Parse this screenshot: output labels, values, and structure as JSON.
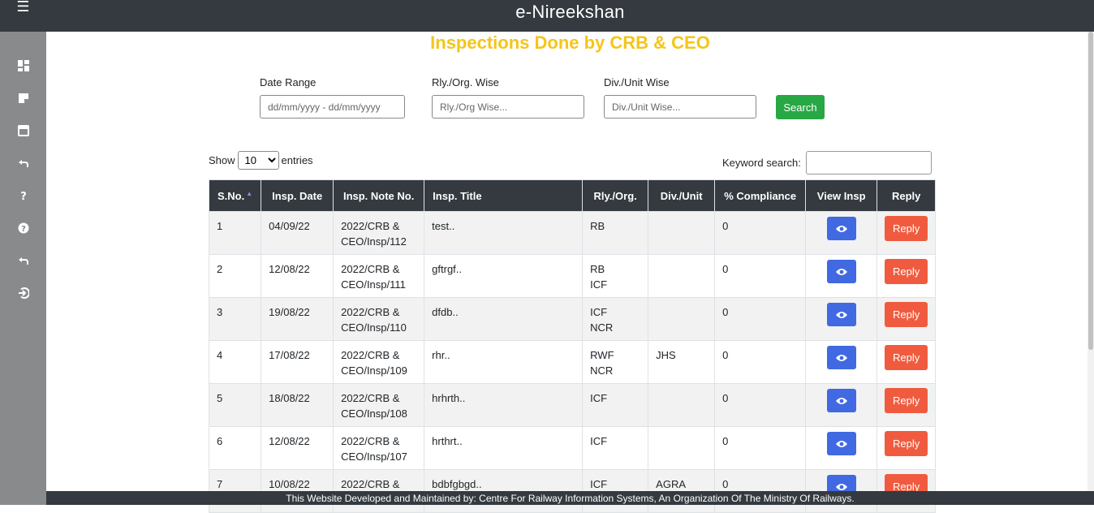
{
  "app": {
    "title": "e-Nireekshan"
  },
  "page": {
    "heading": "Inspections Done by CRB & CEO"
  },
  "filters": {
    "date_range_label": "Date Range",
    "date_range_placeholder": "dd/mm/yyyy - dd/mm/yyyy",
    "rly_label": "Rly./Org. Wise",
    "rly_placeholder": "Rly./Org Wise...",
    "div_label": "Div./Unit Wise",
    "div_placeholder": "Div./Unit Wise...",
    "search_label": "Search"
  },
  "table_controls": {
    "show_label": "Show",
    "entries_value": "10",
    "entries_label": "entries",
    "keyword_label": "Keyword search:"
  },
  "table": {
    "headers": [
      "S.No.",
      "Insp. Date",
      "Insp. Note No.",
      "Insp. Title",
      "Rly./Org.",
      "Div./Unit",
      "% Compliance",
      "View Insp",
      "Reply"
    ],
    "reply_label": "Reply",
    "rows": [
      {
        "sno": "1",
        "date": "04/09/22",
        "note_a": "2022/CRB &",
        "note_b": "CEO/Insp/112",
        "title": "test..",
        "rly_a": "RB",
        "rly_b": "",
        "div": "",
        "compliance": "0"
      },
      {
        "sno": "2",
        "date": "12/08/22",
        "note_a": "2022/CRB &",
        "note_b": "CEO/Insp/111",
        "title": "gftrgf..",
        "rly_a": "RB",
        "rly_b": "ICF",
        "div": "",
        "compliance": "0"
      },
      {
        "sno": "3",
        "date": "19/08/22",
        "note_a": "2022/CRB &",
        "note_b": "CEO/Insp/110",
        "title": "dfdb..",
        "rly_a": "ICF",
        "rly_b": "NCR",
        "div": "",
        "compliance": "0"
      },
      {
        "sno": "4",
        "date": "17/08/22",
        "note_a": "2022/CRB &",
        "note_b": "CEO/Insp/109",
        "title": "rhr..",
        "rly_a": "RWF",
        "rly_b": "NCR",
        "div": "JHS",
        "compliance": "0"
      },
      {
        "sno": "5",
        "date": "18/08/22",
        "note_a": "2022/CRB &",
        "note_b": "CEO/Insp/108",
        "title": "hrhrth..",
        "rly_a": "ICF",
        "rly_b": "",
        "div": "",
        "compliance": "0"
      },
      {
        "sno": "6",
        "date": "12/08/22",
        "note_a": "2022/CRB &",
        "note_b": "CEO/Insp/107",
        "title": "hrthrt..",
        "rly_a": "ICF",
        "rly_b": "",
        "div": "",
        "compliance": "0"
      },
      {
        "sno": "7",
        "date": "10/08/22",
        "note_a": "2022/CRB &",
        "note_b": "",
        "title": "bdbfgbgd..",
        "rly_a": "ICF",
        "rly_b": "",
        "div": "AGRA",
        "compliance": "0"
      }
    ]
  },
  "footer": {
    "text": "This Website Developed and Maintained by: Centre For Railway Information Systems, An Organization Of The Ministry Of Railways."
  },
  "colors": {
    "header_dark": "#343a40",
    "title_yellow": "#f5c518",
    "search_green": "#28a745",
    "view_blue": "#4169e1",
    "reply_red": "#f05b3f"
  },
  "sidebar_icons": [
    "dashboard-icon",
    "tag-icon",
    "calendar-icon",
    "undo-icon",
    "help-icon",
    "info-icon",
    "undo-icon",
    "logout-icon"
  ]
}
